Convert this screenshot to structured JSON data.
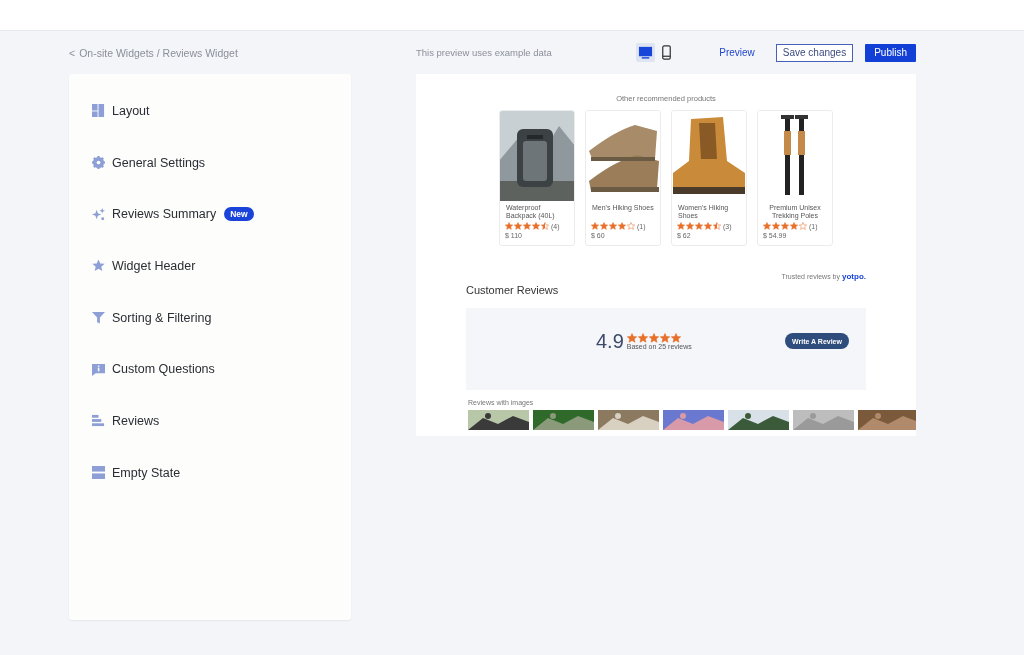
{
  "breadcrumb": {
    "back": "<",
    "path": "On-site Widgets / Reviews Widget"
  },
  "sidebar": {
    "items": [
      {
        "label": "Layout"
      },
      {
        "label": "General Settings"
      },
      {
        "label": "Reviews Summary",
        "badge": "New"
      },
      {
        "label": "Widget Header"
      },
      {
        "label": "Sorting & Filtering"
      },
      {
        "label": "Custom Questions"
      },
      {
        "label": "Reviews"
      },
      {
        "label": "Empty State"
      }
    ]
  },
  "toolbar": {
    "note": "This preview uses example data",
    "devices": [
      {
        "kind": "desktop",
        "selected": true
      },
      {
        "kind": "mobile",
        "selected": false
      }
    ],
    "preview_link": "Preview",
    "save_button": "Save changes",
    "publish_button": "Publish"
  },
  "preview": {
    "recommended_title": "Other recommended products",
    "products": [
      {
        "name": "Waterproof Backpack (40L)",
        "stars": 4.5,
        "count": "(4)",
        "price": "$ 110"
      },
      {
        "name": "Men's Hiking Shoes",
        "stars": 4,
        "count": "(1)",
        "price": "$ 60"
      },
      {
        "name": "Women's Hiking Shoes",
        "stars": 4.5,
        "count": "(3)",
        "price": "$ 62"
      },
      {
        "name": "Premium Unisex Trekking Poles",
        "stars": 4,
        "count": "(1)",
        "price": "$ 54.99"
      }
    ],
    "trusted_by": "Trusted reviews by",
    "brand": "yotpo.",
    "reviews_title": "Customer Reviews",
    "summary": {
      "score": "4.9",
      "stars": 5,
      "based_on": "Based on 25 reviews",
      "write_button": "Write A Review"
    },
    "images_title": "Reviews with images"
  }
}
